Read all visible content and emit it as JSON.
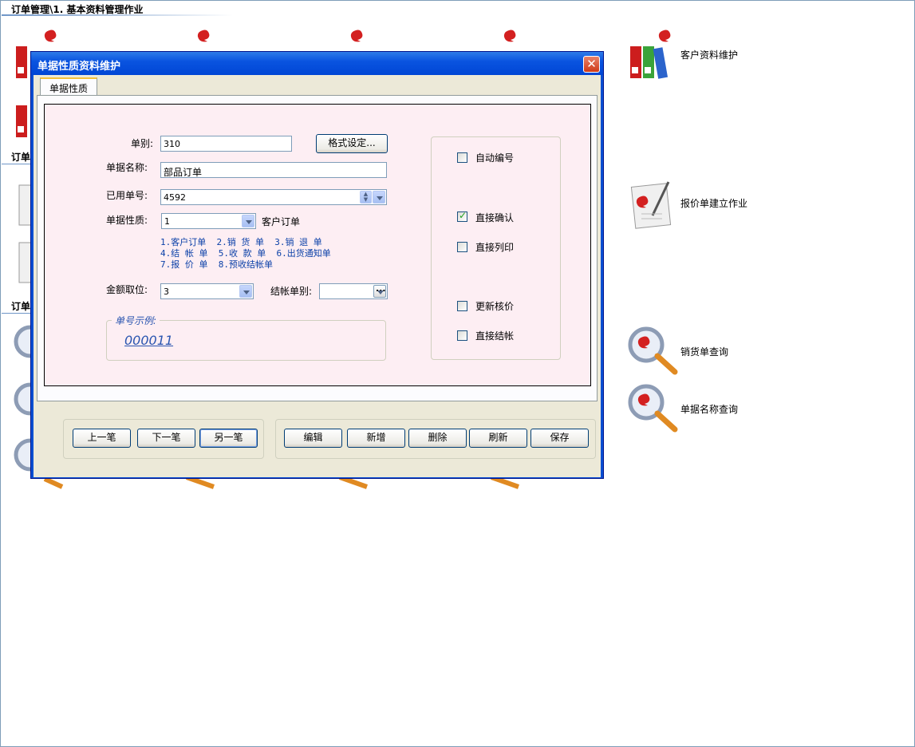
{
  "breadcrumb": "订单管理\\1. 基本资料管理作业",
  "sections": {
    "s2": "订单",
    "s3": "订单"
  },
  "background_labels": {
    "customer": "客户资料维护",
    "quote": "报价单建立作业",
    "sales_query": "销货单查询",
    "doc_name_query": "单据名称查询"
  },
  "dialog": {
    "title": "单据性质资料维护",
    "close_icon": "close-icon",
    "tab": "单据性质",
    "form": {
      "doc_type_label": "单别:",
      "doc_type_value": "310",
      "format_button": "格式设定...",
      "doc_name_label": "单据名称:",
      "doc_name_value": "部品订单",
      "used_no_label": "已用单号:",
      "used_no_value": "4592",
      "nature_label": "单据性质:",
      "nature_value": "1",
      "nature_text": "客户订单",
      "nature_options": [
        "1.客户订单  2.销 货 单  3.销 退 单",
        "4.结 帐 单  5.收 款 单  6.出货通知单",
        "7.报 价 单  8.预收结帐单"
      ],
      "amount_label": "金额取位:",
      "amount_value": "3",
      "settle_label": "结帐单别:",
      "settle_value": "",
      "example_label": "单号示例:",
      "example_value": "000011"
    },
    "options": [
      {
        "label": "自动编号",
        "checked": false
      },
      {
        "label": "直接确认",
        "checked": true
      },
      {
        "label": "直接列印",
        "checked": false
      },
      {
        "label": "更新核价",
        "checked": false
      },
      {
        "label": "直接结帐",
        "checked": false
      }
    ],
    "nav_buttons": [
      "上一笔",
      "下一笔",
      "另一笔"
    ],
    "action_buttons": [
      "编辑",
      "新增",
      "删除",
      "刷新",
      "保存"
    ]
  }
}
